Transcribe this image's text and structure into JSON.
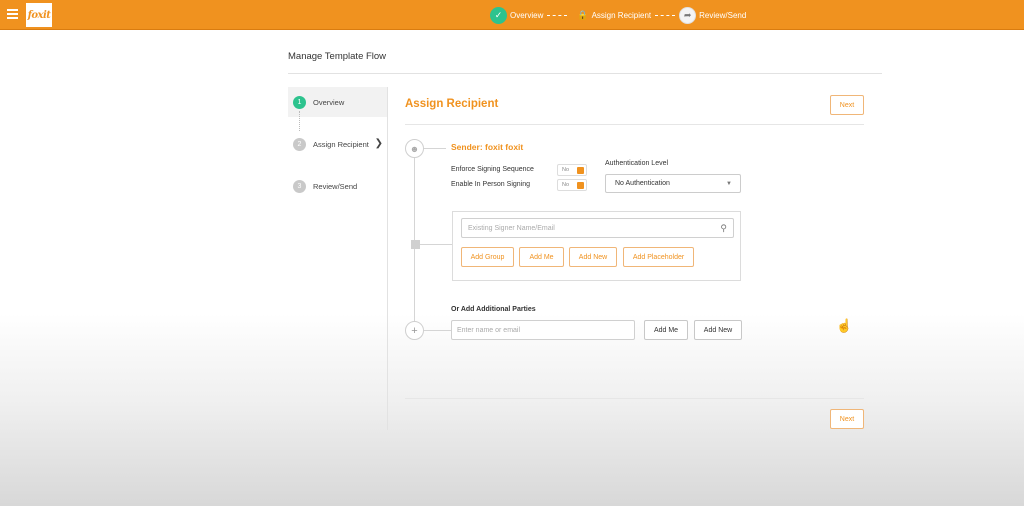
{
  "header": {
    "logo_text": "foxit",
    "steps": [
      {
        "label": "Overview",
        "icon": "check-location-icon"
      },
      {
        "label": "Assign Recipient",
        "icon": "person-lock-icon"
      },
      {
        "label": "Review/Send",
        "icon": "share-arrow-icon"
      }
    ],
    "colors": {
      "bar": "#f0921f",
      "done": "#2dc38e"
    }
  },
  "page_title": "Manage Template Flow",
  "sidebar": {
    "steps": [
      {
        "num": "1",
        "label": "Overview"
      },
      {
        "num": "2",
        "label": "Assign Recipient"
      },
      {
        "num": "3",
        "label": "Review/Send"
      }
    ]
  },
  "main": {
    "title": "Assign Recipient",
    "next_label": "Next",
    "sender_label": "Sender: foxit foxit",
    "enforce_label": "Enforce Signing Sequence",
    "enforce_value": "No",
    "in_person_label": "Enable In Person Signing",
    "in_person_value": "No",
    "auth_label": "Authentication Level",
    "auth_value": "No Authentication",
    "signer_placeholder": "Existing Signer Name/Email",
    "signer_buttons": [
      "Add Group",
      "Add Me",
      "Add New",
      "Add Placeholder"
    ],
    "additional_label": "Or Add Additional Parties",
    "additional_placeholder": "Enter name or email",
    "additional_add_me": "Add Me",
    "additional_add_new": "Add New"
  }
}
